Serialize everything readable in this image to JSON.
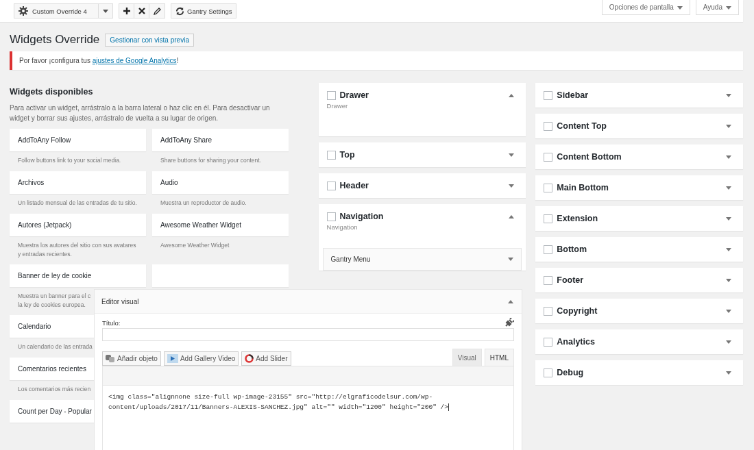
{
  "toolbar": {
    "override": "Custom Override 4",
    "settings_button": "Gantry Settings"
  },
  "screen_meta": [
    {
      "label": "Opciones de pantalla",
      "expanded": false
    },
    {
      "label": "Ayuda",
      "expanded": false
    }
  ],
  "page_title": "Widgets Override",
  "preview_button": "Gestionar con vista previa",
  "notice": {
    "before": "Por favor ¡configura tus ",
    "link": "ajustes de Google Analytics",
    "after": "!"
  },
  "available": {
    "title": "Widgets disponibles",
    "description": "Para activar un widget, arrástralo a la barra lateral o haz clic en él. Para desactivar un widget y borrar sus ajustes, arrástralo de vuelta a su lugar de origen.",
    "rows": [
      [
        {
          "kind": "widget",
          "name": "AddToAny Follow",
          "desc": "Follow buttons link to your social media."
        },
        {
          "kind": "widget",
          "name": "AddToAny Share",
          "desc": "Share buttons for sharing your content."
        }
      ],
      [
        {
          "kind": "widget",
          "name": "Archivos",
          "desc": "Un listado mensual de las entradas de tu sitio."
        },
        {
          "kind": "widget",
          "name": "Audio",
          "desc": "Muestra un reproductor de audio."
        }
      ],
      [
        {
          "kind": "widget",
          "name": "Autores (Jetpack)",
          "desc": "Muestra los autores del sitio con sus avatares y entradas recientes."
        },
        {
          "kind": "widget",
          "name": "Awesome Weather Widget",
          "desc": "Awesome Weather Widget"
        }
      ],
      [
        {
          "kind": "widget",
          "name": "Banner de ley de cookie",
          "desc": "Muestra un banner para el c\nla ley de cookies europea."
        },
        {
          "kind": "blank"
        }
      ],
      [
        {
          "kind": "widget",
          "name": "Calendario",
          "desc": "Un calendario de las entrada"
        }
      ],
      [
        {
          "kind": "widget",
          "name": "Comentarios recientes",
          "desc": "Los comentarios más recien"
        }
      ],
      [
        {
          "kind": "widget",
          "name": "Count per Day - Popular"
        }
      ]
    ]
  },
  "areas_middle": [
    {
      "name": "Drawer",
      "checked": false,
      "expanded": true,
      "description": "Drawer"
    },
    {
      "name": "Top",
      "checked": false,
      "expanded": false
    },
    {
      "name": "Header",
      "checked": false,
      "expanded": false
    },
    {
      "name": "Navigation",
      "checked": false,
      "expanded": true,
      "description": "Navigation",
      "widgets": [
        {
          "name": "Gantry Menu",
          "expanded": false
        }
      ]
    }
  ],
  "areas_right": [
    {
      "name": "Sidebar",
      "checked": false,
      "expanded": false
    },
    {
      "name": "Content Top",
      "checked": false,
      "expanded": false
    },
    {
      "name": "Content Bottom",
      "checked": false,
      "expanded": false
    },
    {
      "name": "Main Bottom",
      "checked": false,
      "expanded": false
    },
    {
      "name": "Extension",
      "checked": false,
      "expanded": false
    },
    {
      "name": "Bottom",
      "checked": false,
      "expanded": false
    },
    {
      "name": "Footer",
      "checked": false,
      "expanded": false
    },
    {
      "name": "Copyright",
      "checked": false,
      "expanded": false
    },
    {
      "name": "Analytics",
      "checked": false,
      "expanded": false
    },
    {
      "name": "Debug",
      "checked": false,
      "expanded": false
    }
  ],
  "editor": {
    "title": "Editor visual",
    "expanded": true,
    "field_label": "Título:",
    "media_buttons": [
      {
        "kind": "object",
        "label": "Añadir objeto"
      },
      {
        "kind": "video",
        "label": "Add Gallery Video"
      },
      {
        "kind": "slider",
        "label": "Add Slider"
      }
    ],
    "tabs": [
      {
        "label": "Visual",
        "selected": false
      },
      {
        "label": "HTML",
        "selected": true
      }
    ],
    "content": "<img class=\"alignnone size-full wp-image-23155\" src=\"http://elgraficodelsur.com/wp-content/uploads/2017/11/Banners-ALEXIS-SANCHEZ.jpg\" alt=\"\" width=\"1200\" height=\"200\" />"
  }
}
